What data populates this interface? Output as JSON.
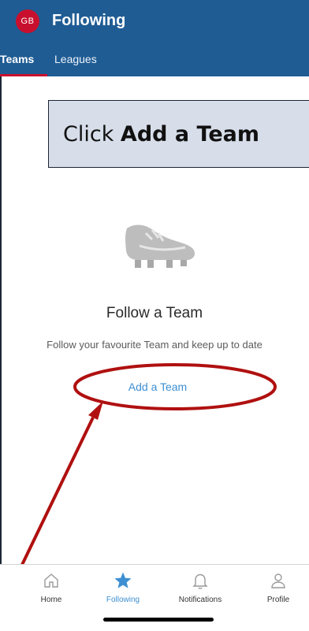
{
  "header": {
    "avatar_initials": "GB",
    "title": "Following",
    "tabs": [
      {
        "label": "Teams",
        "active": true
      },
      {
        "label": "Leagues",
        "active": false
      }
    ]
  },
  "callout": {
    "prefix": "Click ",
    "bold": "Add a Team"
  },
  "empty_state": {
    "icon": "football-boot-icon",
    "title": "Follow a Team",
    "subtitle": "Follow your favourite Team and keep up to date",
    "action_label": "Add a Team"
  },
  "tab_bar": {
    "items": [
      {
        "label": "Home",
        "icon": "home-icon",
        "active": false
      },
      {
        "label": "Following",
        "icon": "star-icon",
        "active": true
      },
      {
        "label": "Notifications",
        "icon": "bell-icon",
        "active": false
      },
      {
        "label": "Profile",
        "icon": "person-icon",
        "active": false
      }
    ]
  },
  "colors": {
    "header_bg": "#1f5c94",
    "accent_red": "#c8102e",
    "link_blue": "#3c8fd2",
    "annotation_red": "#b01010"
  }
}
